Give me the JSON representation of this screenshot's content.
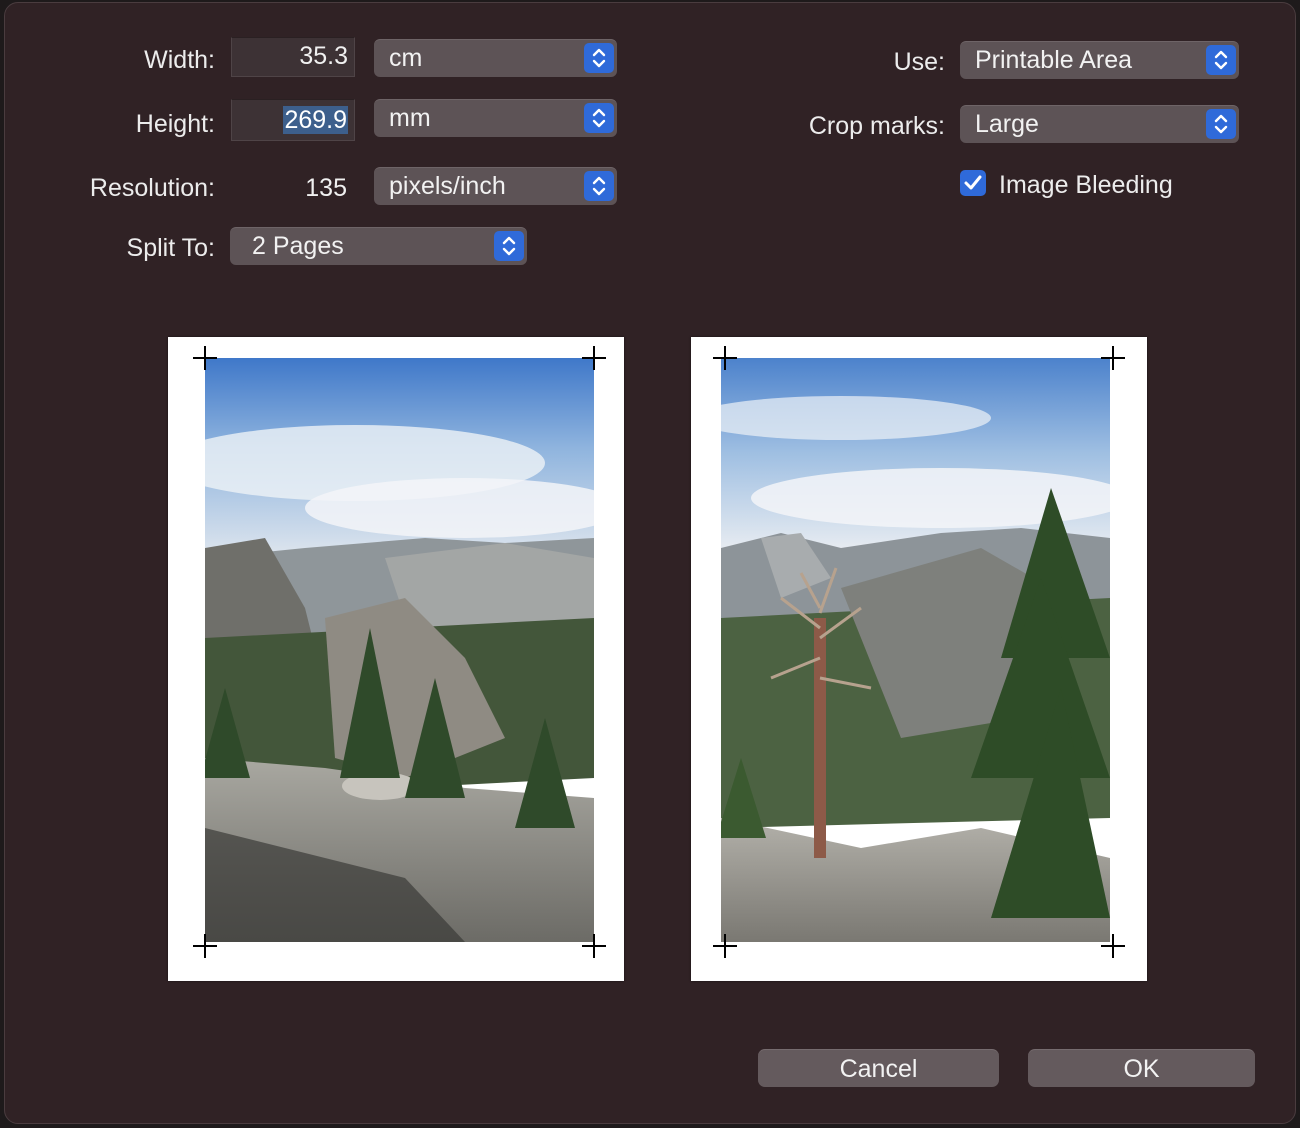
{
  "form": {
    "width_label": "Width:",
    "width_value": "35.3",
    "width_unit": "cm",
    "height_label": "Height:",
    "height_value": "269.9",
    "height_unit": "mm",
    "resolution_label": "Resolution:",
    "resolution_value": "135",
    "resolution_unit": "pixels/inch",
    "split_label": "Split To:",
    "split_value": "2 Pages"
  },
  "options": {
    "use_label": "Use:",
    "use_value": "Printable Area",
    "crop_label": "Crop marks:",
    "crop_value": "Large",
    "bleeding_label": "Image Bleeding",
    "bleeding_checked": true
  },
  "buttons": {
    "cancel": "Cancel",
    "ok": "OK"
  },
  "colors": {
    "background": "#302225",
    "accent": "#2f6ad9",
    "control": "#5d5356"
  }
}
